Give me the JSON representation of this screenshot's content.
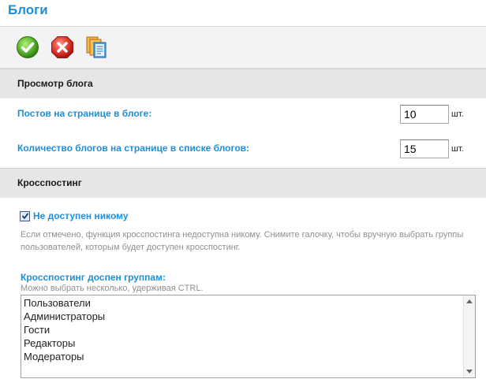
{
  "page": {
    "title": "Блоги"
  },
  "toolbar": {
    "buttons": [
      {
        "icon": "check-icon",
        "color": "#5bb52f"
      },
      {
        "icon": "cancel-icon",
        "color": "#d9352e"
      },
      {
        "icon": "copy-icon",
        "color": "#e08a1e"
      }
    ]
  },
  "blog_view": {
    "header": "Просмотр блога",
    "posts_per_page": {
      "label": "Постов на странице в блоге:",
      "value": "10",
      "unit": "шт."
    },
    "blogs_per_page": {
      "label": "Количество блогов на странице в списке блогов:",
      "value": "15",
      "unit": "шт."
    }
  },
  "crossposting": {
    "header": "Кросспостинг",
    "checkbox": {
      "label": "Не доступен никому",
      "checked": true
    },
    "hint": "Если отмечено, функция кросспостинга недоступна никому. Снимите галочку, чтобы вручную выбрать группы пользователей, которым будет доступен кросспостинг.",
    "groups_label": "Кросспостинг доспен группам:",
    "groups_hint": "Можно выбрать несколько, удерживая CTRL.",
    "groups": [
      "Пользователи",
      "Администраторы",
      "Гости",
      "Редакторы",
      "Модераторы"
    ]
  },
  "colors": {
    "accent": "#1f8fd6",
    "hint_text": "#8f8f8f",
    "section_bg": "#e6e6e6"
  }
}
